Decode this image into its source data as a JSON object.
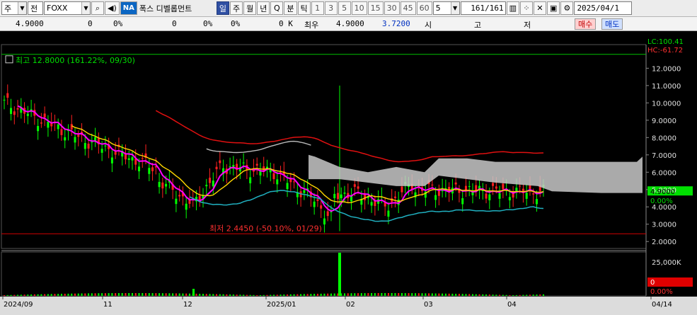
{
  "toolbar": {
    "market": "주",
    "type": "전",
    "symbol": "FOXX",
    "search_icon": "magnifier-icon",
    "audio_icon": "speaker-icon",
    "na": "NA",
    "name": "폭스 디벨롭먼트",
    "periods": [
      "일",
      "주",
      "월",
      "년",
      "Q",
      "분",
      "틱"
    ],
    "minutes": [
      "1",
      "3",
      "5",
      "10",
      "15",
      "30",
      "45",
      "60"
    ],
    "count": "5",
    "page": "161",
    "total": "/161",
    "date": "2025/04/1"
  },
  "quote": {
    "price": "4.9000",
    "change": "0",
    "change_pct": "0%",
    "volume": "0",
    "vol_pct": "0%",
    "vol_pct2": "0%",
    "amount": "0 K",
    "best_label": "최우",
    "best": "4.9000",
    "best2": "3.7200",
    "open_label": "시",
    "high_label": "고",
    "low_label": "저",
    "buy": "매수",
    "sell": "매도"
  },
  "chart_data": {
    "type": "candlestick",
    "annotations": {
      "high": "최고 12.8000 (161.22%, 09/30)",
      "low": "최저 2.4450 (-50.10%, 01/29)"
    },
    "price_axis": [
      "12.0000",
      "11.0000",
      "10.0000",
      "9.0000",
      "8.0000",
      "7.0000",
      "6.0000",
      "5.0000",
      "4.0000",
      "3.0000",
      "2.0000"
    ],
    "lc": "LC:100.41",
    "hc": "HC:-61.72",
    "last_price": "4.9000",
    "last_pct": "0.00%",
    "volume_axis": "25,000K",
    "volume_zero": "0",
    "volume_pct": "0.00%",
    "date_axis": [
      "2024/09",
      "11",
      "12",
      "2025/01",
      "02",
      "03",
      "04",
      "04/14"
    ],
    "high_value": 12.8,
    "low_value": 2.445,
    "ylim": [
      1.6,
      13.2
    ],
    "colors": {
      "up": "#00ff00",
      "down": "#ff2020",
      "ma_fast": "#ff00ff",
      "ma_mid": "#ffd700",
      "band_upper": "#e01010",
      "band_lower": "#20b0c0",
      "cloud": "#c8c8c8",
      "lag": "#ff3333"
    }
  }
}
